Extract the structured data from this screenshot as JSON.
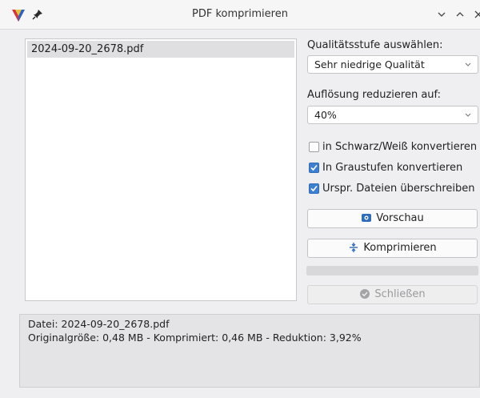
{
  "window": {
    "title": "PDF komprimieren",
    "controls": [
      "minimize",
      "maximize",
      "close"
    ]
  },
  "file_list": {
    "items": [
      "2024-09-20_2678.pdf"
    ],
    "selected_index": 0
  },
  "quality": {
    "label": "Qualitätsstufe auswählen:",
    "value": "Sehr niedrige Qualität"
  },
  "resolution": {
    "label": "Auflösung reduzieren auf:",
    "value": "40%"
  },
  "options": [
    {
      "label": "in Schwarz/Weiß konvertieren",
      "checked": false
    },
    {
      "label": "In Graustufen konvertieren",
      "checked": true
    },
    {
      "label": "Urspr. Dateien überschreiben",
      "checked": true
    }
  ],
  "buttons": {
    "preview": "Vorschau",
    "compress": "Komprimieren",
    "close": "Schließen"
  },
  "progress": 0,
  "info": {
    "line1": "Datei: 2024-09-20_2678.pdf",
    "line2": "Originalgröße: 0,48 MB - Komprimiert: 0,46 MB - Reduktion: 3,92%"
  },
  "colors": {
    "accent": "#3d7fd1",
    "brand_red": "#d8343a",
    "brand_blue": "#2a63c7"
  },
  "icons": [
    "app-logo-icon",
    "pin-icon",
    "chevron-down-icon",
    "chevron-up-icon",
    "close-icon",
    "preview-icon",
    "compress-icon",
    "check-circle-icon"
  ]
}
